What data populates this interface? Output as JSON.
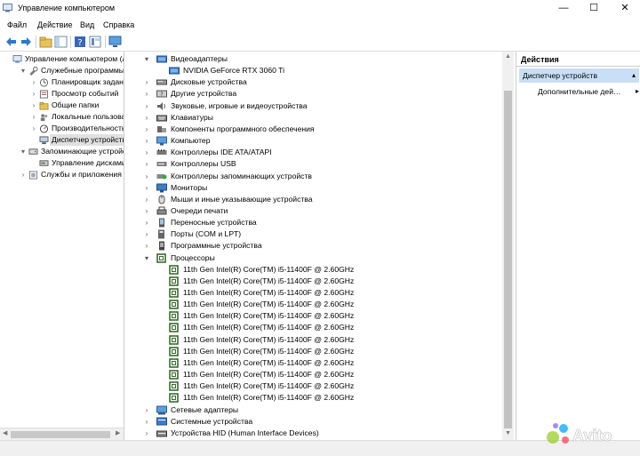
{
  "window": {
    "title": "Управление компьютером",
    "controls": {
      "minimize": "—",
      "maximize": "☐",
      "close": "✕"
    }
  },
  "menu": {
    "items": [
      "Файл",
      "Действие",
      "Вид",
      "Справка"
    ]
  },
  "toolbar": {
    "buttons": [
      "back-arrow-icon",
      "forward-arrow-icon",
      "up-folder-icon",
      "show-tree-icon",
      "help-icon",
      "properties-icon",
      "monitor-icon"
    ]
  },
  "left_tree": {
    "items": [
      {
        "label": "Управление компьютером (л",
        "icon": "computer-management-icon",
        "expander": "",
        "level": 0
      },
      {
        "label": "Служебные программы",
        "icon": "tools-icon",
        "expander": "▾",
        "level": 1
      },
      {
        "label": "Планировщик заданий",
        "icon": "clock-icon",
        "expander": "›",
        "level": 2
      },
      {
        "label": "Просмотр событий",
        "icon": "event-viewer-icon",
        "expander": "›",
        "level": 2
      },
      {
        "label": "Общие папки",
        "icon": "shared-folder-icon",
        "expander": "›",
        "level": 2
      },
      {
        "label": "Локальные пользовате",
        "icon": "users-icon",
        "expander": "›",
        "level": 2
      },
      {
        "label": "Производительность",
        "icon": "performance-icon",
        "expander": "›",
        "level": 2
      },
      {
        "label": "Диспетчер устройств",
        "icon": "device-manager-icon",
        "expander": "",
        "level": 2,
        "selected": true
      },
      {
        "label": "Запоминающие устройст",
        "icon": "storage-icon",
        "expander": "▾",
        "level": 1
      },
      {
        "label": "Управление дисками",
        "icon": "disk-management-icon",
        "expander": "",
        "level": 2
      },
      {
        "label": "Службы и приложения",
        "icon": "services-icon",
        "expander": "›",
        "level": 1
      }
    ]
  },
  "device_tree": {
    "items": [
      {
        "label": "Видеоадаптеры",
        "icon": "display-adapter-icon",
        "expander": "▾",
        "level": 0
      },
      {
        "label": "NVIDIA GeForce RTX 3060 Ti",
        "icon": "display-adapter-icon",
        "expander": "",
        "level": 1
      },
      {
        "label": "Дисковые устройства",
        "icon": "disk-drive-icon",
        "expander": "›",
        "level": 0
      },
      {
        "label": "Другие устройства",
        "icon": "other-devices-icon",
        "expander": "›",
        "level": 0
      },
      {
        "label": "Звуковые, игровые и видеоустройства",
        "icon": "sound-icon",
        "expander": "›",
        "level": 0
      },
      {
        "label": "Клавиатуры",
        "icon": "keyboard-icon",
        "expander": "›",
        "level": 0
      },
      {
        "label": "Компоненты программного обеспечения",
        "icon": "software-component-icon",
        "expander": "›",
        "level": 0
      },
      {
        "label": "Компьютер",
        "icon": "computer-icon",
        "expander": "›",
        "level": 0
      },
      {
        "label": "Контроллеры IDE ATA/ATAPI",
        "icon": "ide-controller-icon",
        "expander": "›",
        "level": 0
      },
      {
        "label": "Контроллеры USB",
        "icon": "usb-icon",
        "expander": "›",
        "level": 0
      },
      {
        "label": "Контроллеры запоминающих устройств",
        "icon": "storage-controller-icon",
        "expander": "›",
        "level": 0
      },
      {
        "label": "Мониторы",
        "icon": "monitor-icon",
        "expander": "›",
        "level": 0
      },
      {
        "label": "Мыши и иные указывающие устройства",
        "icon": "mouse-icon",
        "expander": "›",
        "level": 0
      },
      {
        "label": "Очереди печати",
        "icon": "print-queue-icon",
        "expander": "›",
        "level": 0
      },
      {
        "label": "Переносные устройства",
        "icon": "portable-device-icon",
        "expander": "›",
        "level": 0
      },
      {
        "label": "Порты (COM и LPT)",
        "icon": "port-icon",
        "expander": "›",
        "level": 0
      },
      {
        "label": "Программные устройства",
        "icon": "software-device-icon",
        "expander": "›",
        "level": 0
      },
      {
        "label": "Процессоры",
        "icon": "processor-icon",
        "expander": "▾",
        "level": 0
      },
      {
        "label": "11th Gen Intel(R) Core(TM) i5-11400F @ 2.60GHz",
        "icon": "processor-icon",
        "expander": "",
        "level": 1
      },
      {
        "label": "11th Gen Intel(R) Core(TM) i5-11400F @ 2.60GHz",
        "icon": "processor-icon",
        "expander": "",
        "level": 1
      },
      {
        "label": "11th Gen Intel(R) Core(TM) i5-11400F @ 2.60GHz",
        "icon": "processor-icon",
        "expander": "",
        "level": 1
      },
      {
        "label": "11th Gen Intel(R) Core(TM) i5-11400F @ 2.60GHz",
        "icon": "processor-icon",
        "expander": "",
        "level": 1
      },
      {
        "label": "11th Gen Intel(R) Core(TM) i5-11400F @ 2.60GHz",
        "icon": "processor-icon",
        "expander": "",
        "level": 1
      },
      {
        "label": "11th Gen Intel(R) Core(TM) i5-11400F @ 2.60GHz",
        "icon": "processor-icon",
        "expander": "",
        "level": 1
      },
      {
        "label": "11th Gen Intel(R) Core(TM) i5-11400F @ 2.60GHz",
        "icon": "processor-icon",
        "expander": "",
        "level": 1
      },
      {
        "label": "11th Gen Intel(R) Core(TM) i5-11400F @ 2.60GHz",
        "icon": "processor-icon",
        "expander": "",
        "level": 1
      },
      {
        "label": "11th Gen Intel(R) Core(TM) i5-11400F @ 2.60GHz",
        "icon": "processor-icon",
        "expander": "",
        "level": 1
      },
      {
        "label": "11th Gen Intel(R) Core(TM) i5-11400F @ 2.60GHz",
        "icon": "processor-icon",
        "expander": "",
        "level": 1
      },
      {
        "label": "11th Gen Intel(R) Core(TM) i5-11400F @ 2.60GHz",
        "icon": "processor-icon",
        "expander": "",
        "level": 1
      },
      {
        "label": "11th Gen Intel(R) Core(TM) i5-11400F @ 2.60GHz",
        "icon": "processor-icon",
        "expander": "",
        "level": 1
      },
      {
        "label": "Сетевые адаптеры",
        "icon": "network-adapter-icon",
        "expander": "›",
        "level": 0
      },
      {
        "label": "Системные устройства",
        "icon": "system-device-icon",
        "expander": "›",
        "level": 0
      },
      {
        "label": "Устройства HID (Human Interface Devices)",
        "icon": "hid-icon",
        "expander": "›",
        "level": 0
      }
    ]
  },
  "actions_pane": {
    "header": "Действия",
    "section": "Диспетчер устройств",
    "section_arrow": "▴",
    "item": "Дополнительные дей…",
    "item_arrow": "▸"
  },
  "watermark": {
    "brand": "Avito"
  },
  "colors": {
    "selection": "#c9dff5",
    "processor_icon": "#3a6b2f",
    "accent_blue": "#2f76c8",
    "avito_green": "#97cf26",
    "avito_blue": "#00aaff",
    "avito_red": "#ff4053",
    "avito_purple": "#965eeb"
  }
}
